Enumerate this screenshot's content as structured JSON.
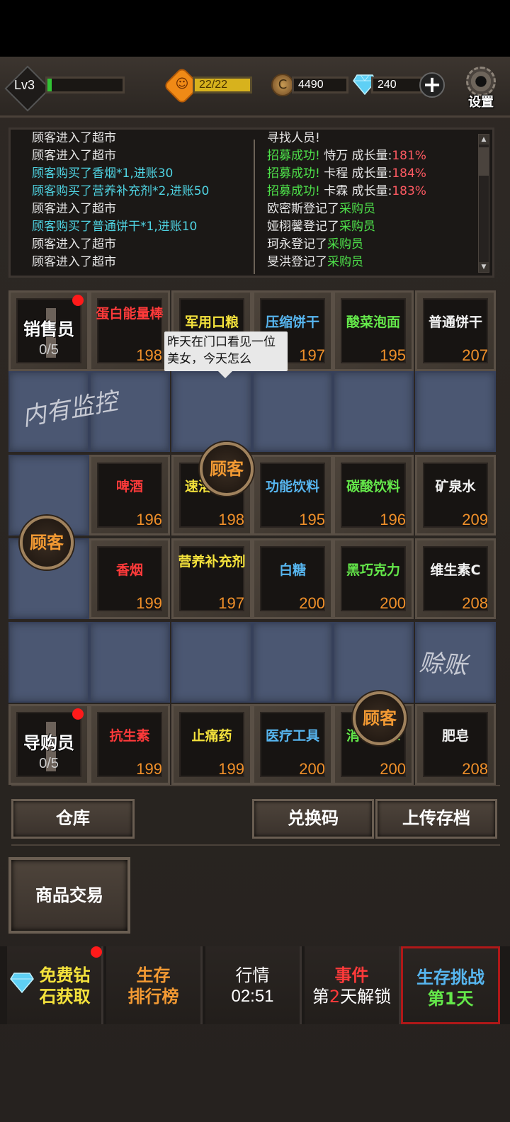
{
  "hud": {
    "level": "Lv3",
    "xp_fraction": 0.06,
    "stamina": "22/22",
    "coins": "4490",
    "gems": "240",
    "settings_label": "设置"
  },
  "log": {
    "left": [
      {
        "text": "顾客进入了超市",
        "color": "w"
      },
      {
        "text": "顾客进入了超市",
        "color": "w"
      },
      {
        "text": "顾客购买了香烟*1,进账30",
        "color": "c"
      },
      {
        "text": "顾客购买了营养补充剂*2,进账50",
        "color": "c"
      },
      {
        "text": "顾客进入了超市",
        "color": "w"
      },
      {
        "text": "顾客购买了普通饼干*1,进账10",
        "color": "c"
      },
      {
        "text": "顾客进入了超市",
        "color": "w"
      },
      {
        "text": "顾客进入了超市",
        "color": "w"
      }
    ],
    "right": [
      {
        "parts": [
          {
            "t": "寻找人员!",
            "c": "w"
          }
        ]
      },
      {
        "parts": [
          {
            "t": "招募成功! ",
            "c": "g"
          },
          {
            "t": "恃万  成长量:",
            "c": "w"
          },
          {
            "t": "181%",
            "c": "r"
          }
        ]
      },
      {
        "parts": [
          {
            "t": "招募成功! ",
            "c": "g"
          },
          {
            "t": "卡程  成长量:",
            "c": "w"
          },
          {
            "t": "184%",
            "c": "r"
          }
        ]
      },
      {
        "parts": [
          {
            "t": "招募成功! ",
            "c": "g"
          },
          {
            "t": "卡霖  成长量:",
            "c": "w"
          },
          {
            "t": "183%",
            "c": "r"
          }
        ]
      },
      {
        "parts": [
          {
            "t": "欧密斯登记了",
            "c": "w"
          },
          {
            "t": "采购员",
            "c": "g"
          }
        ]
      },
      {
        "parts": [
          {
            "t": "娅栩馨登记了",
            "c": "w"
          },
          {
            "t": "采购员",
            "c": "g"
          }
        ]
      },
      {
        "parts": [
          {
            "t": "珂永登记了",
            "c": "w"
          },
          {
            "t": "采购员",
            "c": "g"
          }
        ]
      },
      {
        "parts": [
          {
            "t": "旻洪登记了",
            "c": "w"
          },
          {
            "t": "采购员",
            "c": "g"
          }
        ]
      }
    ]
  },
  "staff": {
    "sales": {
      "label": "销售员",
      "count": "0/5"
    },
    "guide": {
      "label": "导购员",
      "count": "0/5"
    }
  },
  "shelves_row1": [
    {
      "name": "蛋白能量棒",
      "qty": "198",
      "color": "n-red"
    },
    {
      "name": "军用口粮",
      "qty": "198",
      "color": "n-yel"
    },
    {
      "name": "压缩饼干",
      "qty": "197",
      "color": "n-cyan"
    },
    {
      "name": "酸菜泡面",
      "qty": "195",
      "color": "n-grn"
    },
    {
      "name": "普通饼干",
      "qty": "207",
      "color": "n-wht"
    }
  ],
  "shelves_row2": [
    {
      "name": "啤酒",
      "qty": "196",
      "color": "n-red"
    },
    {
      "name": "速溶咖啡",
      "qty": "198",
      "color": "n-yel"
    },
    {
      "name": "功能饮料",
      "qty": "195",
      "color": "n-cyan"
    },
    {
      "name": "碳酸饮料",
      "qty": "196",
      "color": "n-grn"
    },
    {
      "name": "矿泉水",
      "qty": "209",
      "color": "n-wht"
    }
  ],
  "shelves_row3": [
    {
      "name": "香烟",
      "qty": "199",
      "color": "n-red"
    },
    {
      "name": "营养补充剂",
      "qty": "197",
      "color": "n-yel"
    },
    {
      "name": "白糖",
      "qty": "200",
      "color": "n-cyan"
    },
    {
      "name": "黑巧克力",
      "qty": "200",
      "color": "n-grn"
    },
    {
      "name": "维生素C",
      "qty": "208",
      "color": "n-wht"
    }
  ],
  "shelves_row4": [
    {
      "name": "抗生素",
      "qty": "199",
      "color": "n-red"
    },
    {
      "name": "止痛药",
      "qty": "199",
      "color": "n-yel"
    },
    {
      "name": "医疗工具",
      "qty": "200",
      "color": "n-cyan"
    },
    {
      "name": "消毒药水",
      "qty": "200",
      "color": "n-grn"
    },
    {
      "name": "肥皂",
      "qty": "208",
      "color": "n-wht"
    }
  ],
  "customer_label": "顾客",
  "speech": "昨天在门口看见一位美女，今天怎么",
  "graffiti": {
    "monitor": "内有监控",
    "no_credit": "赊账"
  },
  "buttons": {
    "warehouse": "仓库",
    "redeem": "兑换码",
    "upload": "上传存档",
    "trade": "商品交易"
  },
  "tabs": {
    "free_gems_1": "免费钻",
    "free_gems_2": "石获取",
    "rank_1": "生存",
    "rank_2": "排行榜",
    "market_1": "行情",
    "market_2": "02:51",
    "event_1": "事件",
    "event_2a": "第",
    "event_2b": "2",
    "event_2c": "天解锁",
    "challenge_1": "生存挑战",
    "challenge_2": "第1天"
  }
}
